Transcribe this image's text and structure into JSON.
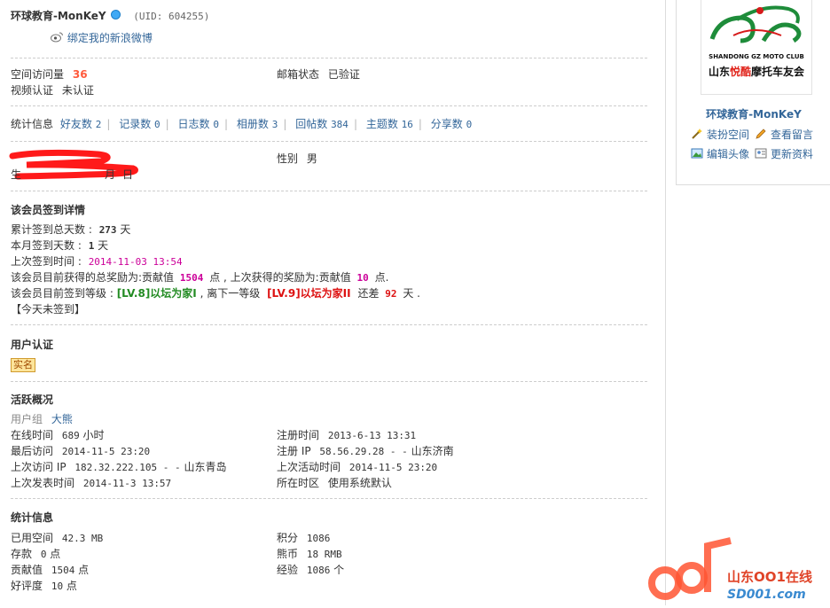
{
  "profile": {
    "username": "环球教育-MonKeY",
    "uid": "(UID: 604255)",
    "weibo_link": "绑定我的新浪微博"
  },
  "basic": {
    "space_visits_label": "空间访问量",
    "space_visits_value": "36",
    "video_auth_label": "视频认证",
    "video_auth_value": "未认证",
    "email_status_label": "邮箱状态",
    "email_status_value": "已验证"
  },
  "stats_bar": {
    "label": "统计信息",
    "items": [
      {
        "label": "好友数",
        "value": "2"
      },
      {
        "label": "记录数",
        "value": "0"
      },
      {
        "label": "日志数",
        "value": "0"
      },
      {
        "label": "相册数",
        "value": "3"
      },
      {
        "label": "回帖数",
        "value": "384"
      },
      {
        "label": "主题数",
        "value": "16"
      },
      {
        "label": "分享数",
        "value": "0"
      }
    ]
  },
  "personal": {
    "gender_label": "性别",
    "gender_value": "男"
  },
  "signin": {
    "title": "该会员签到详情",
    "total_days_label": "累计签到总天数 :",
    "total_days_value": "273",
    "day_unit": "天",
    "month_days_label": "本月签到天数 :",
    "month_days_value": "1",
    "last_time_label": "上次签到时间 :",
    "last_time_value": "2014-11-03 13:54",
    "reward_prefix": "该会员目前获得的总奖励为:贡献值",
    "reward_total": "1504",
    "reward_mid": "点 , 上次获得的奖励为:贡献值",
    "reward_last": "10",
    "reward_suffix": "点.",
    "level_prefix": "该会员目前签到等级 :",
    "level_current": "[LV.8]以坛为家I",
    "level_mid": ", 离下一等级",
    "level_next": "[LV.9]以坛为家II",
    "level_gap_prefix": "还差",
    "level_gap_value": "92",
    "level_gap_suffix": "天 .",
    "today": "【今天未签到】"
  },
  "auth": {
    "title": "用户认证",
    "badge": "实名"
  },
  "activity": {
    "title": "活跃概况",
    "group_label": "用户组",
    "group_value": "大熊",
    "online_label": "在线时间",
    "online_value": "689",
    "online_unit": "小时",
    "reg_time_label": "注册时间",
    "reg_time_value": "2013-6-13 13:31",
    "last_visit_label": "最后访问",
    "last_visit_value": "2014-11-5 23:20",
    "reg_ip_label": "注册 IP",
    "reg_ip_value": "58.56.29.28 - -",
    "reg_ip_loc": "山东济南",
    "last_ip_label": "上次访问 IP",
    "last_ip_value": "182.32.222.105 - -",
    "last_ip_loc": "山东青岛",
    "last_active_label": "上次活动时间",
    "last_active_value": "2014-11-5 23:20",
    "last_post_label": "上次发表时间",
    "last_post_value": "2014-11-3 13:57",
    "timezone_label": "所在时区",
    "timezone_value": "使用系统默认"
  },
  "statistics": {
    "title": "统计信息",
    "used_space_label": "已用空间",
    "used_space_value": "42.3 MB",
    "points_label": "积分",
    "points_value": "1086",
    "deposit_label": "存款",
    "deposit_value": "0",
    "point_unit": "点",
    "currency_label": "熊币",
    "currency_value": "18 RMB",
    "contrib_label": "贡献值",
    "contrib_value": "1504",
    "exp_label": "经验",
    "exp_value": "1086",
    "exp_unit": "个",
    "rating_label": "好评度",
    "rating_value": "10"
  },
  "sidebar": {
    "club_line": "SHANDONG GZ MOTO CLUB",
    "club_name_pre": "山东",
    "club_name_em": "悦酷",
    "club_name_post": "摩托车友会",
    "username": "环球教育-MonKeY",
    "links": [
      "装扮空间",
      "查看留言",
      "编辑头像",
      "更新资料"
    ]
  },
  "watermark": {
    "text": "山东OO1在线",
    "domain": "SD001.com"
  },
  "colors": {
    "link": "#336699",
    "accent_red": "#dd1111",
    "green": "#228b22",
    "pink": "#cc0099"
  }
}
